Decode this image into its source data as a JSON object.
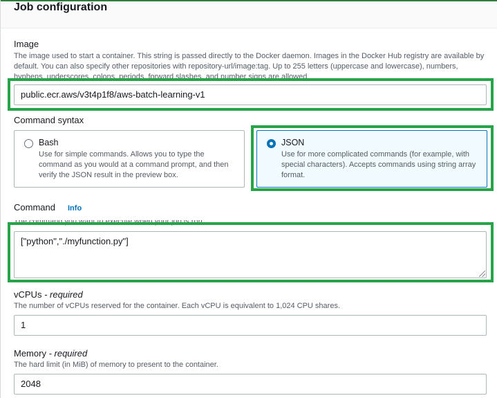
{
  "section": {
    "title": "Job configuration"
  },
  "image": {
    "label": "Image",
    "description_1": "The image used to start a container. This string is passed directly to the Docker daemon. Images in the Docker Hub registry are available by",
    "description_2": "default. You can also specify other repositories with repository-url/image:tag. Up to 255 letters (uppercase and lowercase), numbers,",
    "description_3": "hyphens, underscores, colons, periods, forward slashes, and number signs are allowed.",
    "value": "public.ecr.aws/v3t4p1f8/aws-batch-learning-v1"
  },
  "command_syntax": {
    "label": "Command syntax",
    "options": [
      {
        "title": "Bash",
        "desc_1": "Use for simple commands. Allows you to type the",
        "desc_2": "command as you would at a command prompt, and then",
        "desc_3": "verify the JSON result in the preview box.",
        "selected": false
      },
      {
        "title": "JSON",
        "desc_1": "Use for more complicated commands (for example, with",
        "desc_2": "special characters). Accepts commands using string array",
        "desc_3": "format.",
        "selected": true
      }
    ]
  },
  "command": {
    "label": "Command",
    "info": "Info",
    "description": "The command you want to execute when your job is run.",
    "value": "[\"python\",\"./myfunction.py\"]"
  },
  "vcpus": {
    "label": "vCPUs",
    "required": "- required",
    "description": "The number of vCPUs reserved for the container. Each vCPU is equivalent to 1,024 CPU shares.",
    "value": "1"
  },
  "memory": {
    "label": "Memory",
    "required": "- required",
    "description": "The hard limit (in MiB) of memory to present to the container.",
    "value": "2048"
  },
  "colors": {
    "highlight": "#27a34a",
    "accent": "#0073bb",
    "selected_bg": "#f1faff"
  }
}
